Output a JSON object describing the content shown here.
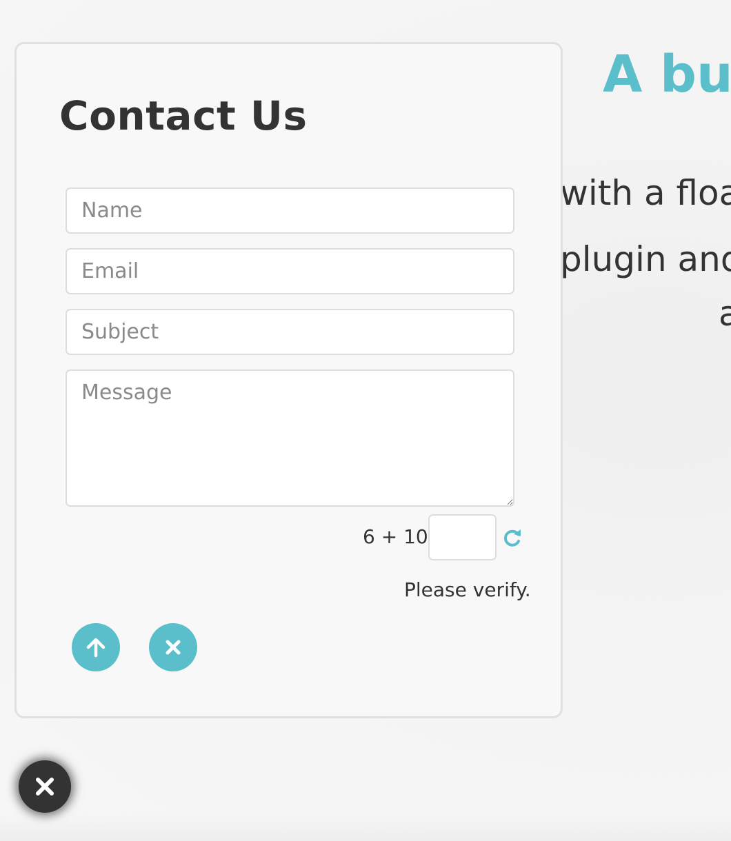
{
  "background": {
    "heading": "A but",
    "lines": [
      "with a floa",
      "plugin and",
      "a"
    ]
  },
  "contact_form": {
    "title": "Contact Us",
    "name_placeholder": "Name",
    "email_placeholder": "Email",
    "subject_placeholder": "Subject",
    "message_placeholder": "Message",
    "captcha_question": "6 + 10=",
    "captcha_status": "Please verify.",
    "submit_icon": "arrow-up-icon",
    "cancel_icon": "close-icon",
    "refresh_icon": "refresh-icon"
  },
  "floating_button": {
    "icon": "close-icon"
  },
  "colors": {
    "accent": "#5bbfcb",
    "text": "#333333",
    "panel_background": "#f8f8f9",
    "panel_border": "#e0e0e0",
    "toggle_background": "#333333"
  }
}
